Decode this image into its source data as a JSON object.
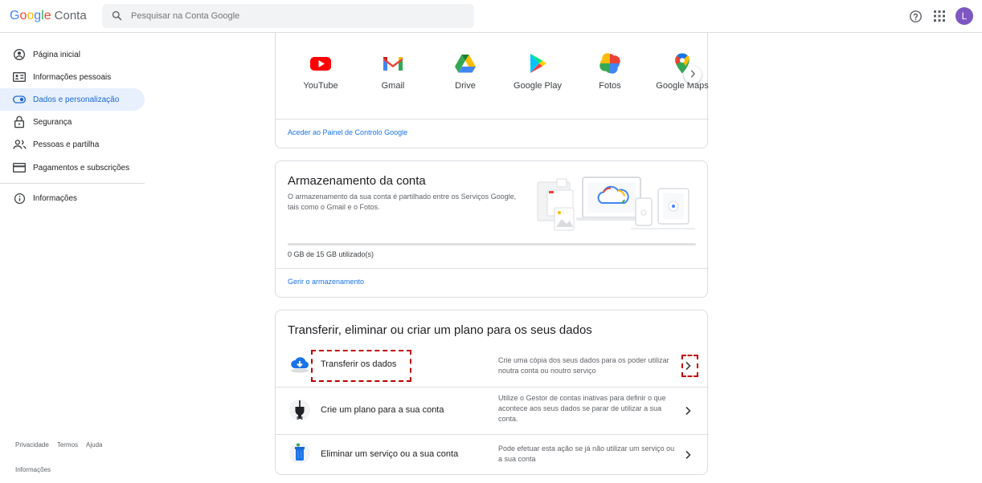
{
  "header": {
    "logo_letters": [
      "G",
      "o",
      "o",
      "g",
      "l",
      "e"
    ],
    "product": "Conta",
    "search_placeholder": "Pesquisar na Conta Google",
    "avatar_letter": "L"
  },
  "sidebar": {
    "items": [
      {
        "label": "Página inicial",
        "icon": "home-icon"
      },
      {
        "label": "Informações pessoais",
        "icon": "id-card-icon"
      },
      {
        "label": "Dados e personalização",
        "icon": "toggle-icon",
        "active": true
      },
      {
        "label": "Segurança",
        "icon": "lock-icon"
      },
      {
        "label": "Pessoas e partilha",
        "icon": "people-icon"
      },
      {
        "label": "Pagamentos e subscrições",
        "icon": "card-icon"
      },
      {
        "label": "Informações",
        "icon": "info-icon"
      }
    ],
    "footer_links": [
      "Privacidade",
      "Termos",
      "Ajuda"
    ],
    "footer_info": "Informações"
  },
  "apps_card": {
    "apps": [
      {
        "label": "YouTube",
        "icon": "youtube-icon"
      },
      {
        "label": "Gmail",
        "icon": "gmail-icon"
      },
      {
        "label": "Drive",
        "icon": "drive-icon"
      },
      {
        "label": "Google Play",
        "icon": "google-play-icon"
      },
      {
        "label": "Fotos",
        "icon": "photos-icon"
      },
      {
        "label": "Google Maps",
        "icon": "maps-icon"
      }
    ],
    "link": "Aceder ao Painel de Controlo Google"
  },
  "storage_card": {
    "title": "Armazenamento da conta",
    "description": "O armazenamento da sua conta é partilhado entre os Serviços Google, tais como o Gmail e o Fotos.",
    "usage_fraction": 0,
    "usage_text": "0 GB de 15 GB utilizado(s)",
    "link": "Gerir o armazenamento"
  },
  "data_card": {
    "title": "Transferir, eliminar ou criar um plano para os seus dados",
    "rows": [
      {
        "label": "Transferir os dados",
        "description": "Crie uma cópia dos seus dados para os poder utilizar noutra conta ou noutro serviço",
        "icon": "cloud-download-icon"
      },
      {
        "label": "Crie um plano para a sua conta",
        "description": "Utilize o Gestor de contas inativas para definir o que acontece aos seus dados se parar de utilizar a sua conta.",
        "icon": "plug-icon"
      },
      {
        "label": "Eliminar um serviço ou a sua conta",
        "description": "Pode efetuar esta ação se já não utilizar um serviço ou a sua conta",
        "icon": "trash-icon"
      }
    ]
  },
  "colors": {
    "accent": "#1a73e8",
    "active_bg": "#e8f0fe",
    "highlight": "#c00000"
  }
}
